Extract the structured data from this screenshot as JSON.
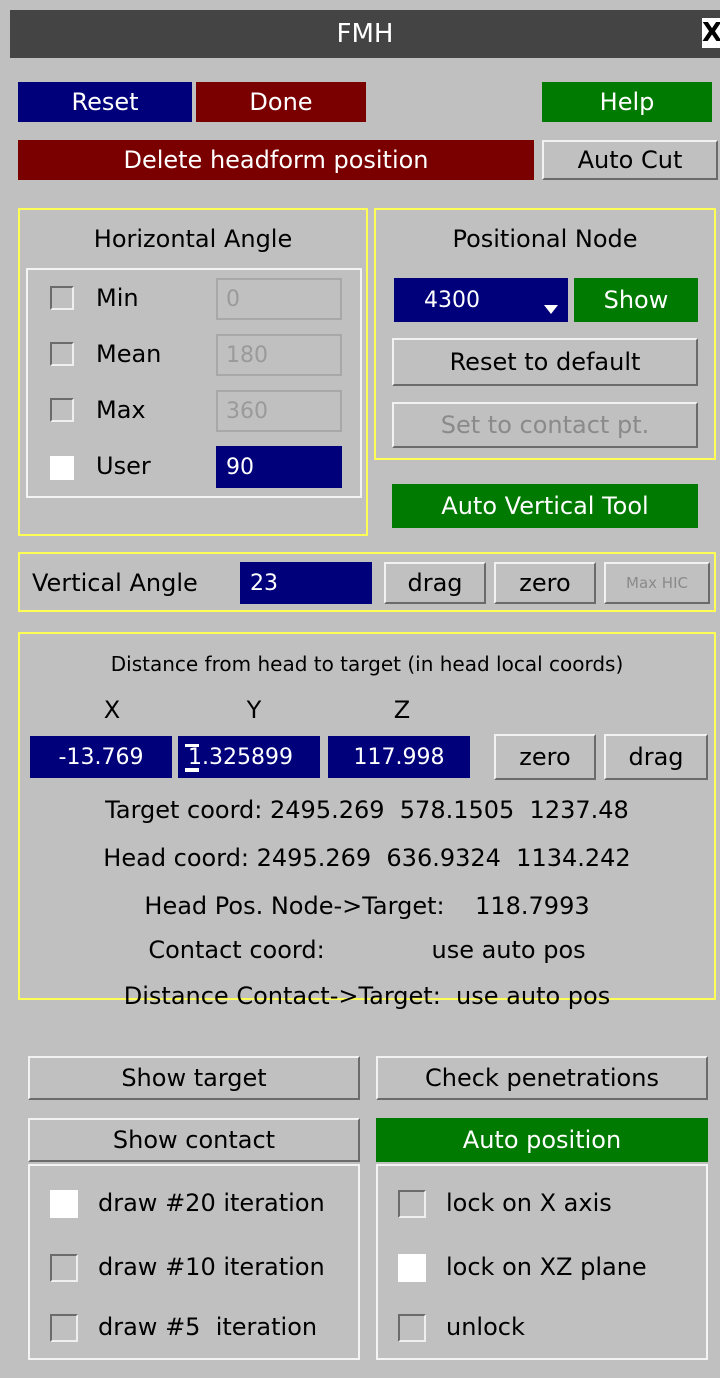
{
  "window": {
    "title": "FMH",
    "close_glyph": "X"
  },
  "buttons": {
    "reset": "Reset",
    "done": "Done",
    "help": "Help",
    "delete_headform": "Delete headform position",
    "auto_cut": "Auto Cut"
  },
  "horizontal_angle": {
    "title": "Horizontal Angle",
    "options": [
      {
        "label": "Min",
        "value": "0",
        "checked": false
      },
      {
        "label": "Mean",
        "value": "180",
        "checked": false
      },
      {
        "label": "Max",
        "value": "360",
        "checked": false
      },
      {
        "label": "User",
        "value": "90",
        "checked": true
      }
    ]
  },
  "positional_node": {
    "title": "Positional Node",
    "node_value": "4300",
    "show_label": "Show",
    "reset_label": "Reset to default",
    "contact_label": "Set to contact pt."
  },
  "auto_vertical_tool": "Auto Vertical Tool",
  "vertical_angle": {
    "label": "Vertical Angle",
    "value": "23",
    "drag_label": "drag",
    "zero_label": "zero",
    "maxhic_label": "Max HIC"
  },
  "distance": {
    "title": "Distance from head to target (in head local coords)",
    "axes": [
      "X",
      "Y",
      "Z"
    ],
    "values": [
      "-13.769",
      "1.325899",
      "117.998"
    ],
    "zero_label": "zero",
    "drag_label": "drag",
    "lines": [
      "Target coord: 2495.269  578.1505  1237.48",
      "Head coord: 2495.269  636.9324  1134.242",
      "Head Pos. Node->Target:    118.7993",
      "Contact coord:              use auto pos",
      "Distance Contact->Target:  use auto pos"
    ]
  },
  "actions": {
    "show_target": "Show target",
    "check_penetrations": "Check penetrations",
    "show_contact": "Show contact",
    "auto_position": "Auto position"
  },
  "draw_options": [
    {
      "label": "draw #20 iteration",
      "checked": true
    },
    {
      "label": "draw #10 iteration",
      "checked": false
    },
    {
      "label": "draw #5  iteration",
      "checked": false
    }
  ],
  "lock_options": [
    {
      "label": "lock on X axis",
      "checked": false
    },
    {
      "label": "lock on XZ plane",
      "checked": true
    },
    {
      "label": "unlock",
      "checked": false
    }
  ],
  "colors": {
    "background": "#c0c0c0",
    "blue": "#00007b",
    "red": "#7a0000",
    "green": "#007a00",
    "panel_border": "#ffff55",
    "titlebar": "#444444"
  },
  "icons": {
    "dropdown": "dropdown-arrow-icon",
    "close": "close-icon"
  }
}
